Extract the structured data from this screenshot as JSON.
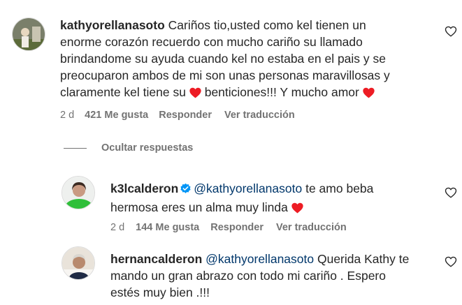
{
  "comment1": {
    "username": "kathyorellanasoto",
    "text_line1": "Cariños tio,usted como kel tienen un",
    "text_line2": "enorme corazón recuerdo con mucho cariño su llamado",
    "text_line3": "brindandome su ayuda cuando kel no estaba en el pais y se",
    "text_line4": "preocuparon ambos de mi son unas personas maravillosas y",
    "text_line5a": "claramente kel tiene su",
    "text_line5b": "benticiones!!! Y mucho amor",
    "time": "2 d",
    "likes": "421 Me gusta",
    "reply": "Responder",
    "translate": "Ver traducción"
  },
  "replies_toggle": {
    "label": "Ocultar respuestas"
  },
  "reply1": {
    "username": "k3lcalderon",
    "mention": "@kathyorellanasoto",
    "text_line1": "te amo beba",
    "text_line2": "hermosa eres un alma muy linda",
    "time": "2 d",
    "likes": "144 Me gusta",
    "reply": "Responder",
    "translate": "Ver traducción"
  },
  "reply2": {
    "username": "hernancalderon",
    "mention": "@kathyorellanasoto",
    "text_line1": "Querida Kathy te",
    "text_line2": "mando un gran abrazo con todo mi cariño . Espero",
    "text_line3": "estés muy bien .!!!"
  },
  "colors": {
    "heart": "#ed1c24",
    "mention": "#00376b",
    "verified": "#0095f6",
    "meta": "#737373"
  },
  "icons": {
    "like": "heart-outline-icon",
    "emoji": "red-heart-emoji",
    "verified": "verified-badge-icon"
  }
}
